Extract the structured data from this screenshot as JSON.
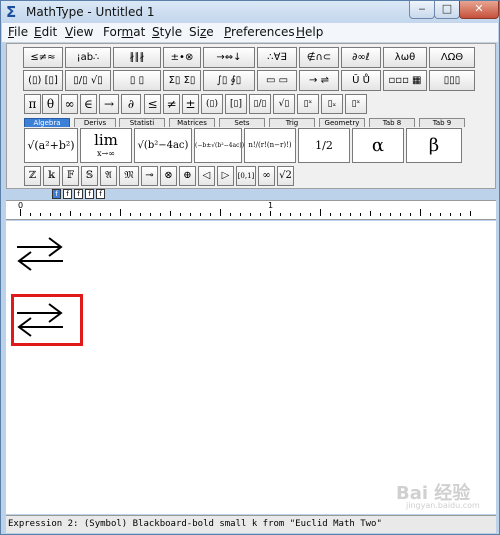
{
  "window": {
    "title": "MathType - Untitled 1",
    "controls": {
      "minimize": "‒",
      "maximize": "□",
      "close": "✕"
    }
  },
  "menu": [
    {
      "label_u": "F",
      "label_rest": "ile"
    },
    {
      "label_u": "E",
      "label_rest": "dit"
    },
    {
      "label_u": "V",
      "label_rest": "iew"
    },
    {
      "label_pre": "For",
      "label_u": "m",
      "label_rest": "at"
    },
    {
      "label_u": "S",
      "label_rest": "tyle"
    },
    {
      "label_pre": "Si",
      "label_u": "z",
      "label_rest": "e"
    },
    {
      "label_u": "P",
      "label_rest": "references"
    },
    {
      "label_u": "H",
      "label_rest": "elp"
    }
  ],
  "palette_row1": [
    "≤≠≈",
    "¡ab∴",
    "∦∥∦",
    "±•⊗",
    "→⇔↓",
    "∴∀∃",
    "∉∩⊂",
    "∂∞ℓ",
    "λωθ",
    "ΛΩΘ"
  ],
  "palette_row2": [
    "(▯) [▯]",
    "▯/▯ √▯",
    "▯ ▯",
    "Σ▯ Σ▯",
    "∫▯ ∮▯",
    "▭ ▭",
    "→ ⇌",
    "Ū Ů",
    "▫▫▫ ▦",
    "▯▯▯"
  ],
  "symbol_row": [
    "π",
    "θ",
    "∞",
    "∈",
    "→",
    "∂",
    "≤",
    "≠",
    "±",
    "(▯)",
    "[▯]",
    "▯/▯",
    "√▯",
    "▯ˣ",
    "▯ₓ",
    "▯ˣ"
  ],
  "tabs": [
    "Algebra",
    "Derivs",
    "Statisti",
    "Matrices",
    "Sets",
    "Trig",
    "Geometry",
    "Tab 8",
    "Tab 9"
  ],
  "templates": [
    "√(a²+b²)",
    "lim",
    "x→∞",
    "√(b²−4ac)",
    "(−b±√(b²−4ac))/2a",
    "n!/(r!(n−r)!)",
    "1/2",
    "α",
    "β"
  ],
  "small_row": [
    "ℤ",
    "𝕜",
    "𝔽",
    "𝕊",
    "𝔄",
    "𝔐",
    "⊸",
    "⊗",
    "⊕",
    "◁",
    "▷",
    "[0,1]",
    "∞",
    "√2"
  ],
  "size_buttons": [
    "f",
    "f",
    "f",
    "f",
    "f"
  ],
  "ruler": {
    "zero": "0",
    "one": "1"
  },
  "status": "Expression 2:  (Symbol) Blackboard-bold small k from \"Euclid Math Two\"",
  "watermark": {
    "main": "Bai 经验",
    "sub": "jingyan.baidu.com"
  },
  "colors": {
    "highlight_box": "#e0191b",
    "active_tab": "#3c7fd6",
    "window_frame": "#bcd2ea"
  }
}
